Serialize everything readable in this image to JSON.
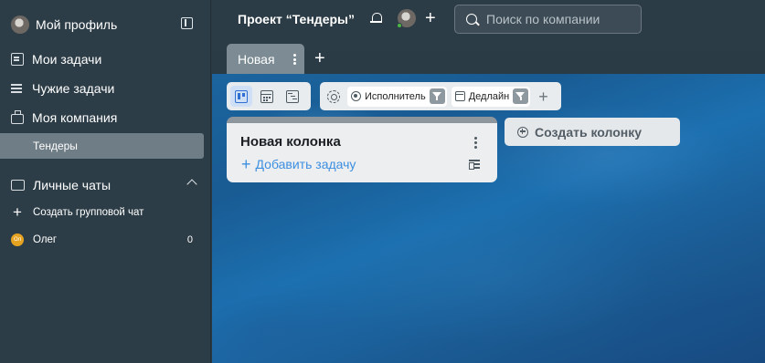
{
  "sidebar": {
    "profile_name": "Мой профиль",
    "items": [
      {
        "label": "Мои задачи",
        "icon": "tasks-icon"
      },
      {
        "label": "Чужие задачи",
        "icon": "list-icon"
      },
      {
        "label": "Моя компания",
        "icon": "briefcase-icon"
      }
    ],
    "selected_item": "Тендеры",
    "chats_header": "Личные чаты",
    "create_group_chat": "Создать групповой чат",
    "chats": [
      {
        "avatar_initials": "Ол",
        "name": "Олег",
        "count": "0",
        "avatar_color": "#e6a321"
      }
    ]
  },
  "header": {
    "project_title": "Проект “Тендеры”",
    "search_placeholder": "Поиск по компании"
  },
  "tabs": [
    {
      "label": "Новая",
      "active": true
    }
  ],
  "toolbar": {
    "views": [
      "board-view-icon",
      "calendar-view-icon",
      "gantt-view-icon"
    ],
    "active_view": "board-view-icon",
    "filters": [
      {
        "label": "Исполнитель",
        "icon": "user-icon"
      },
      {
        "label": "Дедлайн",
        "icon": "calendar-icon"
      }
    ]
  },
  "board": {
    "columns": [
      {
        "title": "Новая колонка",
        "add_task_label": "Добавить задачу"
      }
    ],
    "create_column_label": "Создать колонку"
  },
  "colors": {
    "accent": "#3d8fe0",
    "sidebar_bg": "#2d3d47",
    "selected_bg": "#6f7d86"
  }
}
